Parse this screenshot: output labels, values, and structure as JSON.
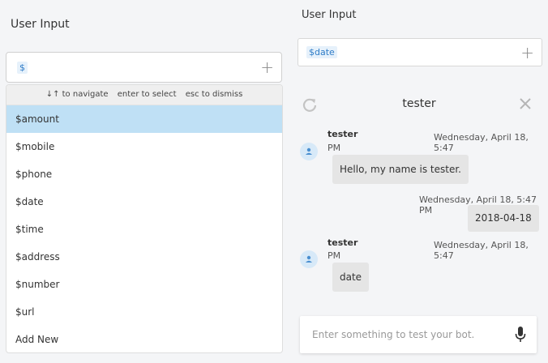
{
  "left_panel": {
    "title": "User Input",
    "input": {
      "token": "$"
    },
    "dropdown": {
      "hint": {
        "navigate": "↓↑ to navigate",
        "select": "enter to select",
        "dismiss": "esc to dismiss"
      },
      "items": [
        "$amount",
        "$mobile",
        "$phone",
        "$date",
        "$time",
        "$address",
        "$number",
        "$url",
        "Add New"
      ],
      "active_index": 0
    }
  },
  "right_panel": {
    "title": "User Input",
    "input": {
      "token": "$date"
    },
    "chat": {
      "title": "tester",
      "messages": [
        {
          "sender": "tester",
          "time_main": "Wednesday, April 18, 5:47",
          "time_suffix": "PM",
          "text": "Hello, my name is tester.",
          "from": "bot"
        },
        {
          "sender": "",
          "time_main": "Wednesday, April 18, 5:47 PM",
          "time_suffix": "",
          "text": "2018-04-18",
          "from": "user"
        },
        {
          "sender": "tester",
          "time_main": "Wednesday, April 18, 5:47",
          "time_suffix": "PM",
          "text": "date",
          "from": "bot"
        }
      ],
      "composer_placeholder": "Enter something to test your bot."
    }
  },
  "colors": {
    "accent_blue": "#2f7cc7",
    "token_bg": "#e6f1fb",
    "active_item": "#bfe0f5",
    "bubble": "#e5e5e5",
    "avatar": "#d7e9f8"
  },
  "icons": [
    "plus-icon",
    "refresh-icon",
    "close-icon",
    "user-avatar-icon",
    "microphone-icon"
  ]
}
